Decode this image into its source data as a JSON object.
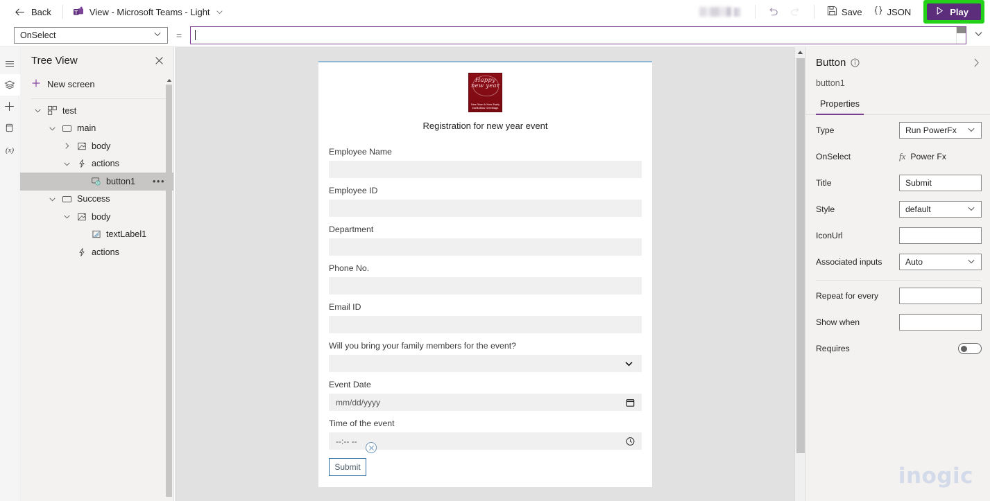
{
  "topbar": {
    "back_label": "Back",
    "view_title": "View - Microsoft Teams - Light",
    "save_label": "Save",
    "json_label": "JSON",
    "play_label": "Play",
    "undo_icon": "undo-icon",
    "redo_icon": "redo-icon",
    "save_icon": "save-icon",
    "json_icon": "json-braces-icon",
    "play_icon": "play-triangle-icon",
    "teams_icon": "microsoft-teams-icon",
    "back_icon": "arrow-left-icon",
    "chevron_icon": "chevron-down-icon",
    "play_highlight_color": "#23d218",
    "play_background_color": "#5b2d7a"
  },
  "formula_bar": {
    "property": "OnSelect",
    "equals": "=",
    "value": "",
    "chevron_icon": "chevron-down-icon",
    "expand_icon": "chevron-down-icon"
  },
  "rail": {
    "items": [
      {
        "icon": "hamburger-menu-icon",
        "name": "menu",
        "active": false
      },
      {
        "icon": "layers-tree-icon",
        "name": "tree-view",
        "active": true
      },
      {
        "icon": "plus-insert-icon",
        "name": "insert",
        "active": false
      },
      {
        "icon": "database-icon",
        "name": "data",
        "active": false
      },
      {
        "icon": "variables-x-icon",
        "name": "variables",
        "active": false
      }
    ]
  },
  "tree": {
    "title": "Tree View",
    "close_icon": "close-icon",
    "new_screen_label": "New screen",
    "new_screen_icon": "plus-icon",
    "nodes": [
      {
        "label": "test",
        "indent": 0,
        "twisty": "chevron-down",
        "icon": "app-grid-icon",
        "selected": false,
        "menu": false
      },
      {
        "label": "main",
        "indent": 1,
        "twisty": "chevron-down",
        "icon": "screen-icon",
        "selected": false,
        "menu": false
      },
      {
        "label": "body",
        "indent": 2,
        "twisty": "chevron-right",
        "icon": "container-icon",
        "selected": false,
        "menu": false
      },
      {
        "label": "actions",
        "indent": 2,
        "twisty": "chevron-down",
        "icon": "lightning-icon",
        "selected": false,
        "menu": false
      },
      {
        "label": "button1",
        "indent": 3,
        "twisty": "none",
        "icon": "button-icon",
        "selected": true,
        "menu": true
      },
      {
        "label": "Success",
        "indent": 1,
        "twisty": "chevron-down",
        "icon": "screen-icon",
        "selected": false,
        "menu": false
      },
      {
        "label": "body",
        "indent": 2,
        "twisty": "chevron-down",
        "icon": "container-icon",
        "selected": false,
        "menu": false
      },
      {
        "label": "textLabel1",
        "indent": 3,
        "twisty": "none",
        "icon": "textlabel-icon",
        "selected": false,
        "menu": false
      },
      {
        "label": "actions",
        "indent": 2,
        "twisty": "none",
        "icon": "lightning-icon",
        "selected": false,
        "menu": false
      }
    ],
    "menu_dots": "•••"
  },
  "form": {
    "logo": {
      "name": "happy-new-year-logo",
      "script_line1": "Happy",
      "script_line2": "new year",
      "caption_line1": "New Year & New Party",
      "caption_line2": "Invitation Greetings",
      "background_color": "#8c0d16"
    },
    "title": "Registration for new year event",
    "fields": [
      {
        "label": "Employee Name",
        "type": "text",
        "value": "",
        "placeholder": ""
      },
      {
        "label": "Employee ID",
        "type": "text",
        "value": "",
        "placeholder": ""
      },
      {
        "label": "Department",
        "type": "text",
        "value": "",
        "placeholder": ""
      },
      {
        "label": "Phone No.",
        "type": "text",
        "value": "",
        "placeholder": ""
      },
      {
        "label": "Email ID",
        "type": "text",
        "value": "",
        "placeholder": ""
      },
      {
        "label": "Will you bring your family members for the event?",
        "type": "select",
        "value": "",
        "placeholder": "",
        "icon": "chevron-down-icon"
      },
      {
        "label": "Event Date",
        "type": "date",
        "value": "",
        "placeholder": "mm/dd/yyyy",
        "icon": "calendar-icon"
      },
      {
        "label": "Time of the event",
        "type": "time",
        "value": "",
        "placeholder": "--:-- --",
        "icon": "clock-icon"
      }
    ],
    "submit_label": "Submit",
    "delete_handle_icon": "circle-x-icon",
    "selection_color": "#2b6ca3"
  },
  "properties": {
    "title": "Button",
    "info_icon": "info-circle-icon",
    "collapse_icon": "chevron-right-icon",
    "control_name": "button1",
    "tabs": [
      {
        "label": "Properties",
        "active": true
      }
    ],
    "rows": [
      {
        "label": "Type",
        "control": "select",
        "value": "Run PowerFx",
        "icon": "chevron-down-icon"
      },
      {
        "label": "OnSelect",
        "control": "fx",
        "value": "Power Fx",
        "icon": "fx-icon"
      },
      {
        "label": "Title",
        "control": "text",
        "value": "Submit"
      },
      {
        "label": "Style",
        "control": "select",
        "value": "default",
        "icon": "chevron-down-icon"
      },
      {
        "label": "IconUrl",
        "control": "text",
        "value": ""
      },
      {
        "label": "Associated inputs",
        "control": "select",
        "value": "Auto",
        "icon": "chevron-down-icon"
      }
    ],
    "rows2": [
      {
        "label": "Repeat for every",
        "control": "text",
        "value": ""
      },
      {
        "label": "Show when",
        "control": "text",
        "value": ""
      },
      {
        "label": "Requires",
        "control": "toggle",
        "value": "off"
      }
    ],
    "accent_color": "#7b3f8f"
  },
  "watermark": {
    "text": "inogic",
    "color": "#d3daea"
  }
}
